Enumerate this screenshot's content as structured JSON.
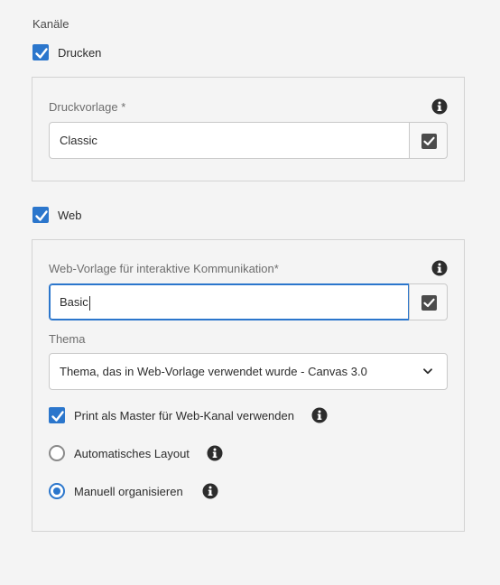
{
  "channels": {
    "title": "Kanäle",
    "print": {
      "label": "Drucken",
      "checked": true,
      "template_label": "Druckvorlage *",
      "template_value": "Classic"
    },
    "web": {
      "label": "Web",
      "checked": true,
      "template_label": "Web-Vorlage für interaktive Kommunikation*",
      "template_value": "Basic",
      "theme_label": "Thema",
      "theme_value": "Thema, das in Web-Vorlage verwendet wurde - Canvas 3.0",
      "print_master_label": "Print als Master für Web-Kanal verwenden",
      "print_master_checked": true,
      "layout_options": [
        {
          "label": "Automatisches Layout",
          "selected": false
        },
        {
          "label": "Manuell organisieren",
          "selected": true
        }
      ]
    }
  },
  "icons": {
    "info": "info-icon",
    "checkbox_check": "check-icon",
    "picker": "checkbox-picker-icon",
    "dropdown": "chevron-down-icon"
  },
  "colors": {
    "accent": "#2b76cc",
    "background": "#f4f4f4",
    "border": "#d3d3d3"
  }
}
